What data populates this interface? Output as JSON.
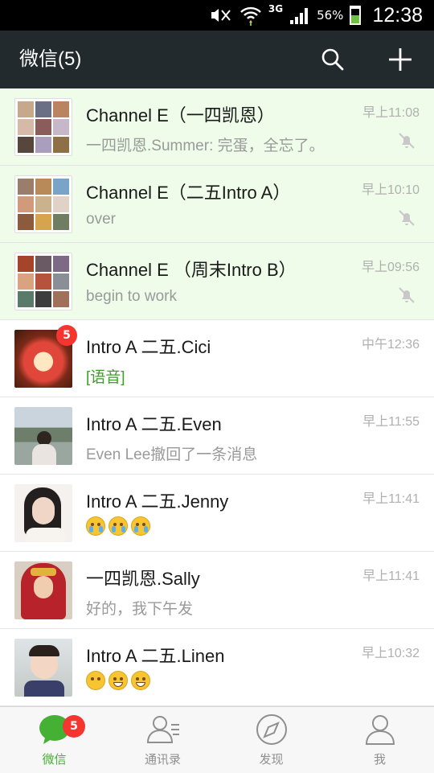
{
  "status_bar": {
    "network": "3G",
    "battery": "56%",
    "time": "12:38"
  },
  "header": {
    "title": "微信(5)"
  },
  "chats": [
    {
      "name": "Channel E（一四凯恩）",
      "preview": "一四凯恩.Summer: 完蛋，全忘了。",
      "time": "早上11:08"
    },
    {
      "name": "Channel E（二五Intro A）",
      "preview": "over",
      "time": "早上10:10"
    },
    {
      "name": "Channel E （周末Intro B）",
      "preview": "begin to work",
      "time": "早上09:56"
    },
    {
      "name": "Intro A 二五.Cici",
      "preview": "[语音]",
      "time": "中午12:36",
      "badge": "5"
    },
    {
      "name": "Intro A 二五.Even",
      "preview": "Even Lee撤回了一条消息",
      "time": "早上11:55"
    },
    {
      "name": "Intro A 二五.Jenny",
      "preview": "",
      "time": "早上11:41"
    },
    {
      "name": "一四凯恩.Sally",
      "preview": "好的，我下午发",
      "time": "早上11:41"
    },
    {
      "name": "Intro A 二五.Linen",
      "preview": "",
      "time": "早上10:32"
    }
  ],
  "tabs": [
    {
      "label": "微信",
      "badge": "5"
    },
    {
      "label": "通讯录"
    },
    {
      "label": "发现"
    },
    {
      "label": "我"
    }
  ],
  "colors": {
    "accent": "#45b134",
    "badge": "#f43530",
    "header": "#232a2d",
    "pinned_bg": "#eefce9"
  },
  "icons": [
    "search-icon",
    "plus-icon",
    "mute-bell-icon",
    "chat-bubble-icon",
    "contacts-icon",
    "compass-icon",
    "person-icon"
  ]
}
